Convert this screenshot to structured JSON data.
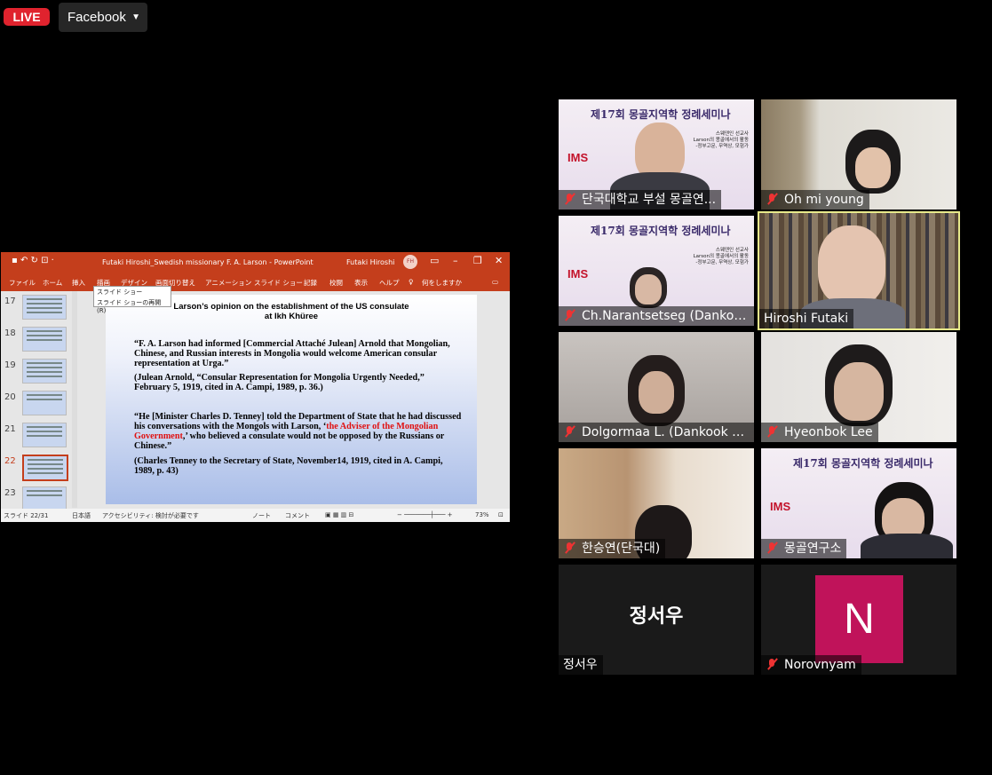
{
  "top": {
    "live_label": "LIVE",
    "platform_label": "Facebook",
    "caret": "▼"
  },
  "ppt": {
    "window_title": "Futaki Hiroshi_Swedish missionary F. A. Larson  -  PowerPoint",
    "user": "Futaki Hiroshi",
    "avatar": "FH",
    "menu": [
      "ファイル",
      "ホーム",
      "挿入",
      "描画",
      "デザイン",
      "画面切り替え",
      "アニメーション",
      "スライド ショー",
      "記録",
      "校閲",
      "表示",
      "ヘルプ",
      "何をしますか"
    ],
    "dropdown": [
      "スライド ショー",
      "スライド ショーの再開(R)"
    ],
    "thumbnails": [
      "17",
      "18",
      "19",
      "20",
      "21",
      "22",
      "23"
    ],
    "selected_thumbnail": "22",
    "slide": {
      "title_line1": "Larson’s opinion on the establishment of the US consulate",
      "title_line2": "at Ikh Khüree",
      "q1": "“F. A. Larson had informed [Commercial Attaché Julean] Arnold that Mongolian, Chinese, and Russian interests in Mongolia would welcome American consular representation at Urga.”",
      "c1": "(Julean Arnold, “Consular Representation for Mongolia Urgently Needed,” February 5, 1919, cited in A. Campi, 1989, p. 36.)",
      "q2_a": "“He [Minister Charles D. Tenney] told the Department of State that he had discussed his conversations with the Mongols with Larson, ‘",
      "q2_red": "the Adviser of the Mongolian Government",
      "q2_b": ",’ who believed a consulate would not be opposed by the Russians or Chinese.”",
      "c2": "(Charles Tenney to the Secretary of State, November14, 1919, cited in A. Campi, 1989, p. 43)"
    },
    "status": {
      "slide": "スライド 22/31",
      "lang": "日本語",
      "access": "アクセシビリティ: 検討が必要です",
      "notes": "ノート",
      "comments": "コメント",
      "zoom": "73%"
    }
  },
  "participants": [
    {
      "name": "단국대학교 부설 몽골연...",
      "muted": true
    },
    {
      "name": "Oh mi young",
      "muted": true
    },
    {
      "name": "Ch.Narantsetseg (Dankoo...",
      "muted": true
    },
    {
      "name": "Hiroshi Futaki",
      "muted": false,
      "active_speaker": true
    },
    {
      "name": "Dolgormaa L. (Dankook U...",
      "muted": true
    },
    {
      "name": "Hyeonbok Lee",
      "muted": true
    },
    {
      "name": "한승연(단국대)",
      "muted": true
    },
    {
      "name": "몽골연구소",
      "muted": true
    },
    {
      "name": "정서우",
      "muted": false,
      "camera_off": true,
      "big_label": "정서우"
    },
    {
      "name": "Norovnyam",
      "muted": true,
      "camera_off": true,
      "avatar_letter": "N"
    }
  ],
  "poster": {
    "title": "제17회 몽골지역학 정례세미나",
    "logo": "IMS",
    "sub1": "스웨덴인 선교사",
    "sub2": "Larson의 몽골에서의 활동",
    "sub3": "-정부고문, 무역상, 모험가"
  },
  "colors": {
    "live": "#e0232e",
    "ppt_red": "#c43e1c",
    "highlight": "#e7e98a",
    "avatar_n": "#c0135a"
  }
}
